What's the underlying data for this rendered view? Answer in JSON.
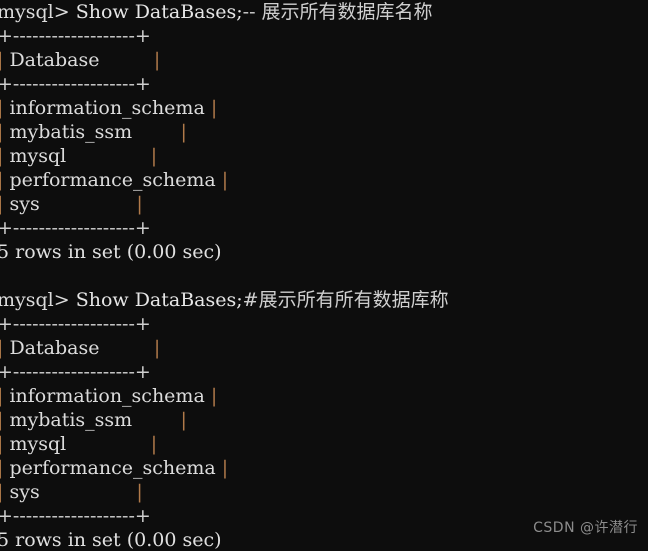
{
  "terminal": {
    "background_color": "#0d0d0d",
    "text_color": "#d8d8d8",
    "pipe_color": "#b07a4a",
    "rule_color": "#cfcfcf"
  },
  "blocks": [
    {
      "prompt": "mysql> ",
      "command": "Show DataBases;",
      "comment": "-- 展示所有数据库名称",
      "table": {
        "top_rule": "+-------------------+",
        "header_row": "| Database          |",
        "header_rule": "+-------------------+",
        "column_header": "Database",
        "rows": [
          "| information_schema |",
          "| mybatis_ssm       |",
          "| mysql             |",
          "| performance_schema |",
          "| sys               |"
        ],
        "values": [
          "information_schema",
          "mybatis_ssm",
          "mysql",
          "performance_schema",
          "sys"
        ],
        "bottom_rule": "+-------------------+"
      },
      "result": "5 rows in set (0.00 sec)"
    },
    {
      "prompt": "mysql> ",
      "command": "Show DataBases;",
      "comment": "#展示所有所有数据库称",
      "table": {
        "top_rule": "+-------------------+",
        "header_row": "| Database          |",
        "header_rule": "+-------------------+",
        "column_header": "Database",
        "rows": [
          "| information_schema |",
          "| mybatis_ssm       |",
          "| mysql             |",
          "| performance_schema |",
          "| sys               |"
        ],
        "values": [
          "information_schema",
          "mybatis_ssm",
          "mysql",
          "performance_schema",
          "sys"
        ],
        "bottom_rule": "+-------------------+"
      },
      "result": "5 rows in set (0.00 sec)"
    }
  ],
  "watermark": "CSDN @许潜行"
}
